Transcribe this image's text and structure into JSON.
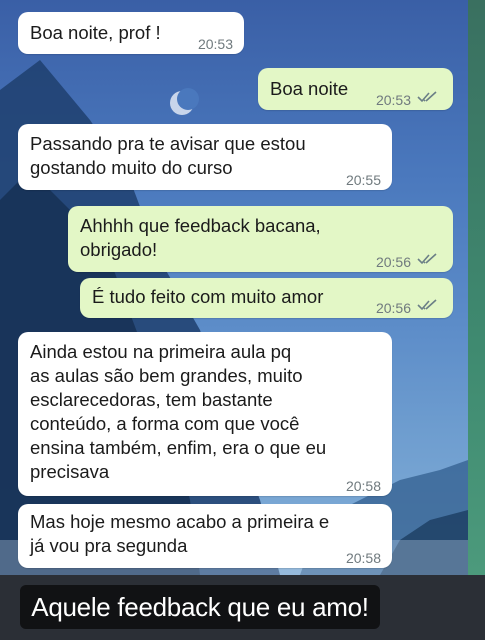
{
  "messages": [
    {
      "text": "Boa noite, prof !",
      "time": "20:53",
      "dir": "in"
    },
    {
      "text": "Boa noite",
      "time": "20:53",
      "dir": "out",
      "status": "read-double-check-icon"
    },
    {
      "text": "Passando pra te avisar que estou\ngostando muito do curso",
      "time": "20:55",
      "dir": "in"
    },
    {
      "text": "Ahhhh que feedback bacana,\nobrigado!",
      "time": "20:56",
      "dir": "out",
      "status": "read-double-check-icon"
    },
    {
      "text": "É tudo feito com muito amor",
      "time": "20:56",
      "dir": "out",
      "status": "read-double-check-icon"
    },
    {
      "text": "Ainda estou na primeira aula pq\nas aulas são bem grandes, muito\nesclarecedoras, tem bastante\nconteúdo, a forma com que você\nensina também, enfim, era o que eu\nprecisava",
      "time": "20:58",
      "dir": "in"
    },
    {
      "text": "Mas hoje mesmo acabo a primeira e\njá vou pra segunda",
      "time": "20:58",
      "dir": "in"
    }
  ],
  "caption": "Aquele feedback que eu amo!",
  "colors": {
    "incoming": "#ffffff",
    "outgoing": "#e3f7c6",
    "caption_bg": "#111214"
  }
}
